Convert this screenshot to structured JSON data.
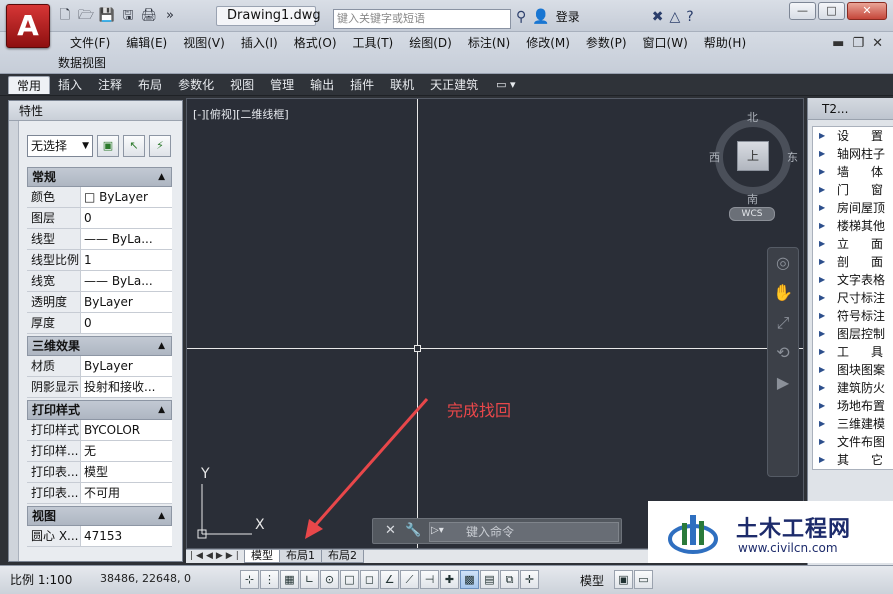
{
  "app": {
    "logo_letter": "A",
    "doc_title": "Drawing1.dwg",
    "search_placeholder": "键入关键字或短语",
    "login": "登录",
    "help": "?",
    "win_min": "—",
    "win_max": "□",
    "win_close": "✕"
  },
  "menu": {
    "items": [
      "文件(F)",
      "编辑(E)",
      "视图(V)",
      "插入(I)",
      "格式(O)",
      "工具(T)",
      "绘图(D)",
      "标注(N)",
      "修改(M)",
      "参数(P)",
      "窗口(W)",
      "帮助(H)"
    ],
    "row2": "数据视图"
  },
  "ribbon": {
    "tabs": [
      "常用",
      "插入",
      "注释",
      "布局",
      "参数化",
      "视图",
      "管理",
      "输出",
      "插件",
      "联机",
      "天正建筑"
    ]
  },
  "properties": {
    "title": "特性",
    "selection": "无选择",
    "sections": [
      {
        "name": "常规",
        "rows": [
          {
            "k": "颜色",
            "v": "□ ByLayer"
          },
          {
            "k": "图层",
            "v": "0"
          },
          {
            "k": "线型",
            "v": "—— ByLa..."
          },
          {
            "k": "线型比例",
            "v": "1"
          },
          {
            "k": "线宽",
            "v": "—— ByLa..."
          },
          {
            "k": "透明度",
            "v": "ByLayer"
          },
          {
            "k": "厚度",
            "v": "0"
          }
        ]
      },
      {
        "name": "三维效果",
        "rows": [
          {
            "k": "材质",
            "v": "ByLayer"
          },
          {
            "k": "阴影显示",
            "v": "投射和接收..."
          }
        ]
      },
      {
        "name": "打印样式",
        "rows": [
          {
            "k": "打印样式",
            "v": "BYCOLOR"
          },
          {
            "k": "打印样...",
            "v": "无"
          },
          {
            "k": "打印表...",
            "v": "模型"
          },
          {
            "k": "打印表...",
            "v": "不可用"
          }
        ]
      },
      {
        "name": "视图",
        "rows": [
          {
            "k": "圆心 X...",
            "v": "47153"
          }
        ]
      }
    ]
  },
  "viewport": {
    "label": "[-][俯视][二维线框]",
    "viewcube_face": "上",
    "north": "北",
    "south": "南",
    "west": "西",
    "east": "东",
    "wcs": "WCS",
    "annotation": "完成找回",
    "ucs_y": "Y",
    "ucs_x": "X"
  },
  "command": {
    "placeholder": "键入命令"
  },
  "layout_tabs": [
    "模型",
    "布局1",
    "布局2"
  ],
  "status": {
    "scale": "比例 1:100",
    "coords": "38486, 22648, 0",
    "model": "模型"
  },
  "tool_palette": {
    "title": "T2...",
    "items": [
      "设置",
      "轴网柱子",
      "墙体",
      "门窗",
      "房间屋顶",
      "楼梯其他",
      "立面",
      "剖面",
      "文字表格",
      "尺寸标注",
      "符号标注",
      "图层控制",
      "工具",
      "图块图案",
      "建筑防火",
      "场地布置",
      "三维建模",
      "文件布图",
      "其它"
    ]
  },
  "watermark": {
    "title": "土木工程网",
    "url": "www.civilcn.com"
  }
}
